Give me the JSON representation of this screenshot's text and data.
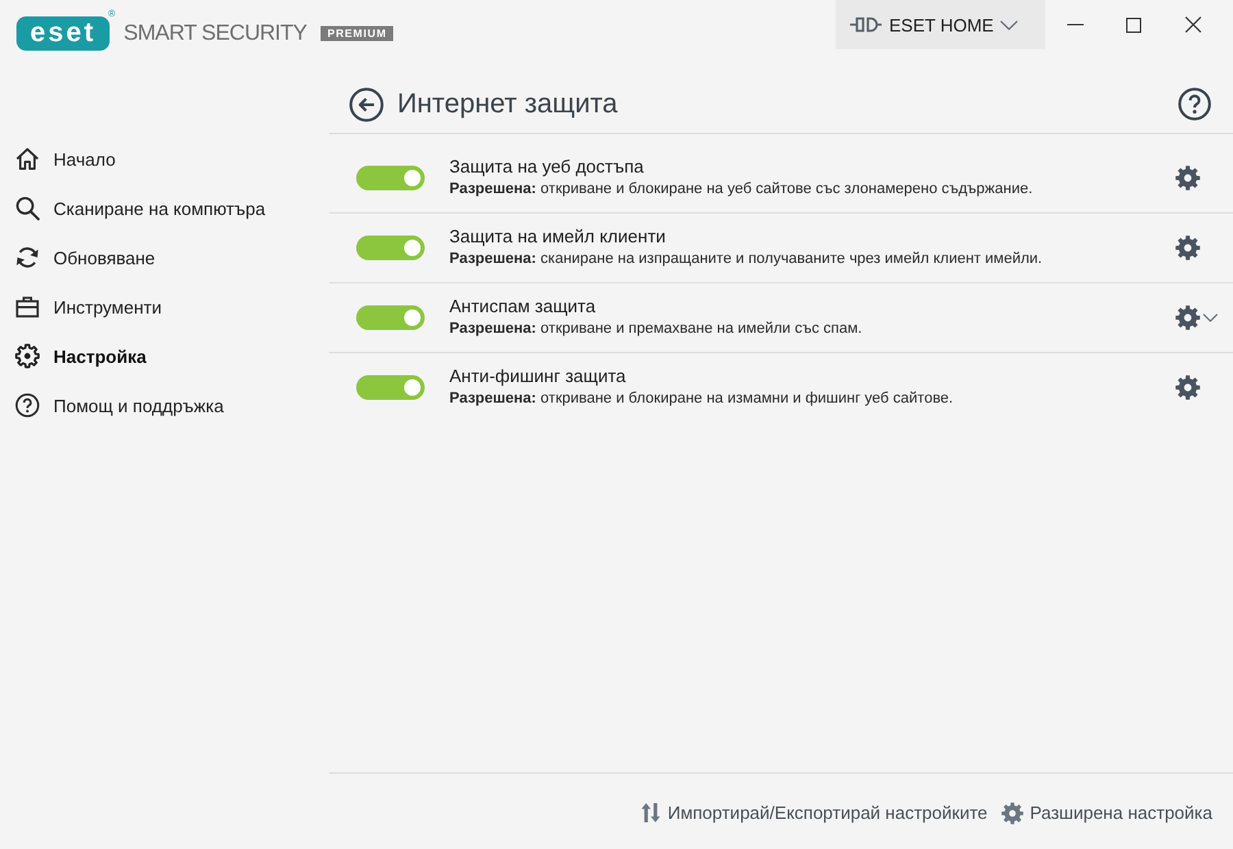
{
  "window": {
    "logo": {
      "text": "eset",
      "mark": "®"
    },
    "product": "SMART SECURITY",
    "edition": "PREMIUM",
    "account_button": {
      "label": "ESET HOME"
    }
  },
  "sidebar": {
    "items": [
      {
        "label": "Начало",
        "selected": false
      },
      {
        "label": "Сканиране на компютъра",
        "selected": false
      },
      {
        "label": "Обновяване",
        "selected": false
      },
      {
        "label": "Инструменти",
        "selected": false
      },
      {
        "label": "Настройка",
        "selected": true
      },
      {
        "label": "Помощ и поддръжка",
        "selected": false
      }
    ]
  },
  "page": {
    "title": "Интернет защита"
  },
  "settings": [
    {
      "title": "Защита на уеб достъпа",
      "description": "**Разрешена:** откриване и блокиране на уеб сайтове със злонамерено съдържание.",
      "on": true,
      "menu": false
    },
    {
      "title": "Защита на имейл клиенти",
      "description": "**Разрешена:** сканиране на изпращаните и получаваните чрез имейл клиент имейли.",
      "on": true,
      "menu": false
    },
    {
      "title": "Антиспам защита",
      "description": "**Разрешена:** откриване и премахване на имейли със спам.",
      "on": true,
      "menu": true
    },
    {
      "title": "Анти-фишинг защита",
      "description": "**Разрешена:** откриване и блокиране на измамни и фишинг уеб сайтове.",
      "on": true,
      "menu": false
    }
  ],
  "footer": {
    "links": [
      {
        "label": "Импортирай/Експортирай настройките"
      },
      {
        "label": "Разширена настройка"
      }
    ]
  }
}
